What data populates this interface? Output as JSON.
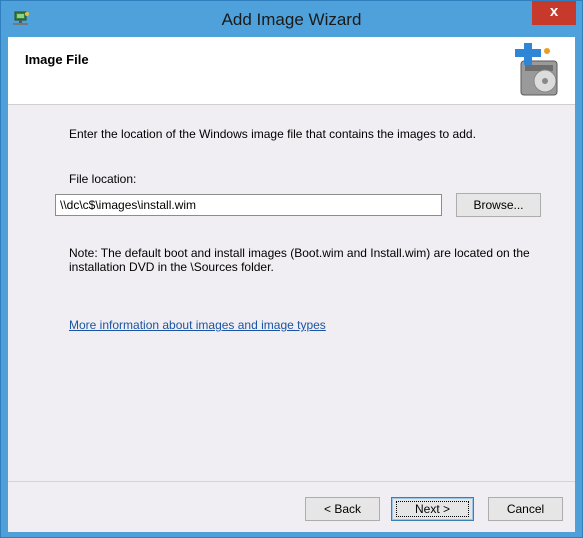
{
  "window": {
    "title": "Add Image Wizard",
    "close_label": "x",
    "accent": "#4ea1da",
    "close_color": "#c7392b"
  },
  "header": {
    "title": "Image File",
    "icon": "add-image-disk-icon"
  },
  "main": {
    "instruction": "Enter the location of the Windows image file that contains the images to add.",
    "file_location_label": "File location:",
    "file_location_value": "\\\\dc\\c$\\images\\install.wim",
    "browse_label": "Browse...",
    "note_line1": "Note: The default boot and install images (Boot.wim and Install.wim) are located on the",
    "note_line2": "installation DVD in the \\Sources folder.",
    "link_text": "More information about images and image types"
  },
  "footer": {
    "back_label": "< Back",
    "next_label": "Next >",
    "cancel_label": "Cancel"
  }
}
